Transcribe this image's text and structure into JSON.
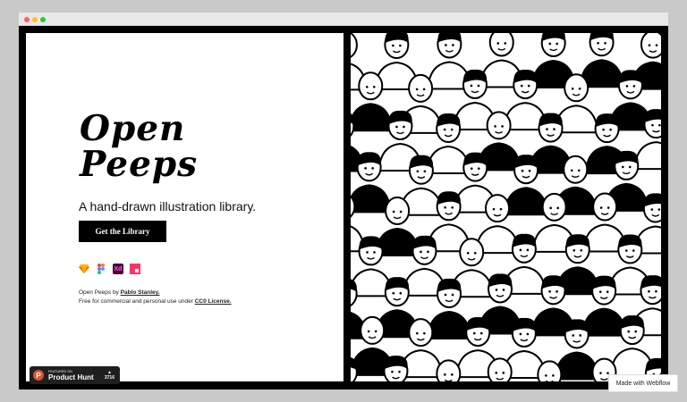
{
  "hero": {
    "title_line1": "Open",
    "title_line2": "Peeps",
    "subtitle": "A hand-drawn illustration library.",
    "cta_label": "Get the Library"
  },
  "tools": [
    {
      "icon": "sketch-icon",
      "label": ""
    },
    {
      "icon": "figma-icon",
      "label": ""
    },
    {
      "icon": "adobe-xd-icon",
      "label": "Xd"
    },
    {
      "icon": "invision-icon",
      "label": ""
    }
  ],
  "credits": {
    "line1_prefix": "Open Peeps by",
    "author": "Pablo Stanley.",
    "line2_prefix": "Free for commercial and personal use under",
    "license": "CC0 License."
  },
  "product_hunt": {
    "featured": "FEATURED ON",
    "name": "Product Hunt",
    "logo": "P",
    "votes": "3716",
    "arrow": "▲"
  },
  "webflow_badge": "Made with Webflow",
  "colors": {
    "background": "#c9c9c9",
    "frame": "#000000",
    "accent_product_hunt": "#da552f",
    "xd": "#470137",
    "invision": "#ff3366"
  }
}
